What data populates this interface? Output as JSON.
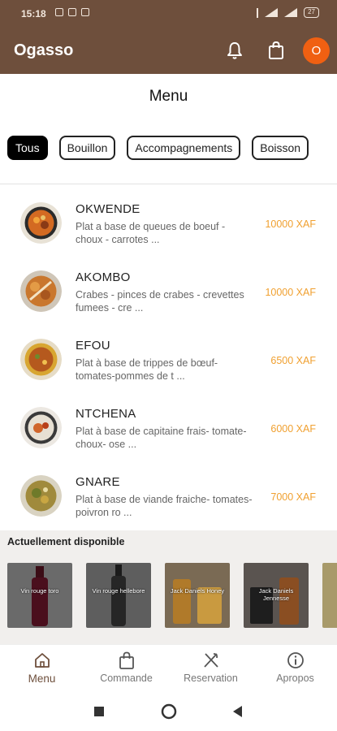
{
  "status_bar": {
    "time": "15:18",
    "battery": "27"
  },
  "app": {
    "title": "Ogasso",
    "avatar_letter": "O"
  },
  "page": {
    "title": "Menu"
  },
  "categories": [
    {
      "label": "Tous",
      "active": true
    },
    {
      "label": "Bouillon",
      "active": false
    },
    {
      "label": "Accompagnements",
      "active": false
    },
    {
      "label": "Boisson",
      "active": false
    }
  ],
  "menu_items": [
    {
      "name": "OKWENDE",
      "desc": "Plat a base de queues de boeuf - choux - carrotes  ...",
      "price": "10000 XAF"
    },
    {
      "name": "AKOMBO",
      "desc": "Crabes - pinces de crabes - crevettes fumees - cre ...",
      "price": "10000 XAF"
    },
    {
      "name": "EFOU",
      "desc": "Plat à base de trippes de bœuf- tomates-pommes de t ...",
      "price": "6500 XAF"
    },
    {
      "name": "NTCHENA",
      "desc": "Plat à base de capitaine frais- tomate- choux- ose ...",
      "price": "6000 XAF"
    },
    {
      "name": "GNARE",
      "desc": "Plat à base de viande fraiche- tomates- poivron ro ...",
      "price": "7000 XAF"
    }
  ],
  "available": {
    "label": "Actuellement disponible",
    "items": [
      {
        "name": "Vin rouge toro"
      },
      {
        "name": "Vin rouge hellebore"
      },
      {
        "name": "Jack Daniels Honey"
      },
      {
        "name": "Jack Daniels Jennesse"
      },
      {
        "name": ""
      }
    ]
  },
  "bottom_nav": [
    {
      "label": "Menu",
      "icon": "home-icon",
      "active": true
    },
    {
      "label": "Commande",
      "icon": "bag-icon",
      "active": false
    },
    {
      "label": "Reservation",
      "icon": "utensils-icon",
      "active": false
    },
    {
      "label": "Apropos",
      "icon": "info-icon",
      "active": false
    }
  ],
  "colors": {
    "brand": "#6e4f3c",
    "accent": "#f06012",
    "price": "#f0a030"
  }
}
